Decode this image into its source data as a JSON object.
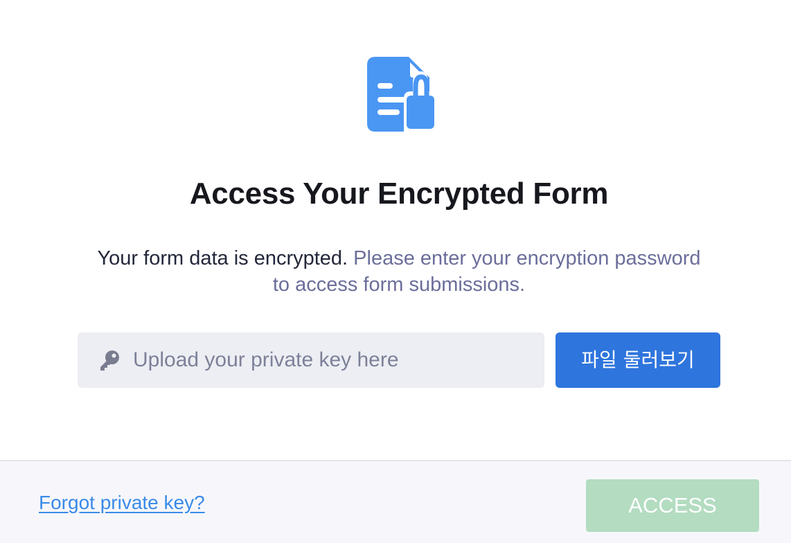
{
  "modal": {
    "hero_icon": "encrypted-document-icon",
    "title": "Access Your Encrypted Form",
    "description": {
      "primary": "Your form data is encrypted.",
      "secondary": "Please enter your encryption password to access form submissions."
    },
    "key_input": {
      "icon": "key-icon",
      "placeholder": "Upload your private key here"
    },
    "browse_button_label": "파일 둘러보기"
  },
  "footer": {
    "forgot_link": "Forgot private key?",
    "access_button_label": "ACCESS"
  },
  "colors": {
    "accent": "#2e75dd",
    "icon": "#4a96f3",
    "link": "#3a8ae8",
    "access_disabled": "#b3dcc1",
    "input_bg": "#edeef3",
    "footer_bg": "#f7f7fb"
  }
}
